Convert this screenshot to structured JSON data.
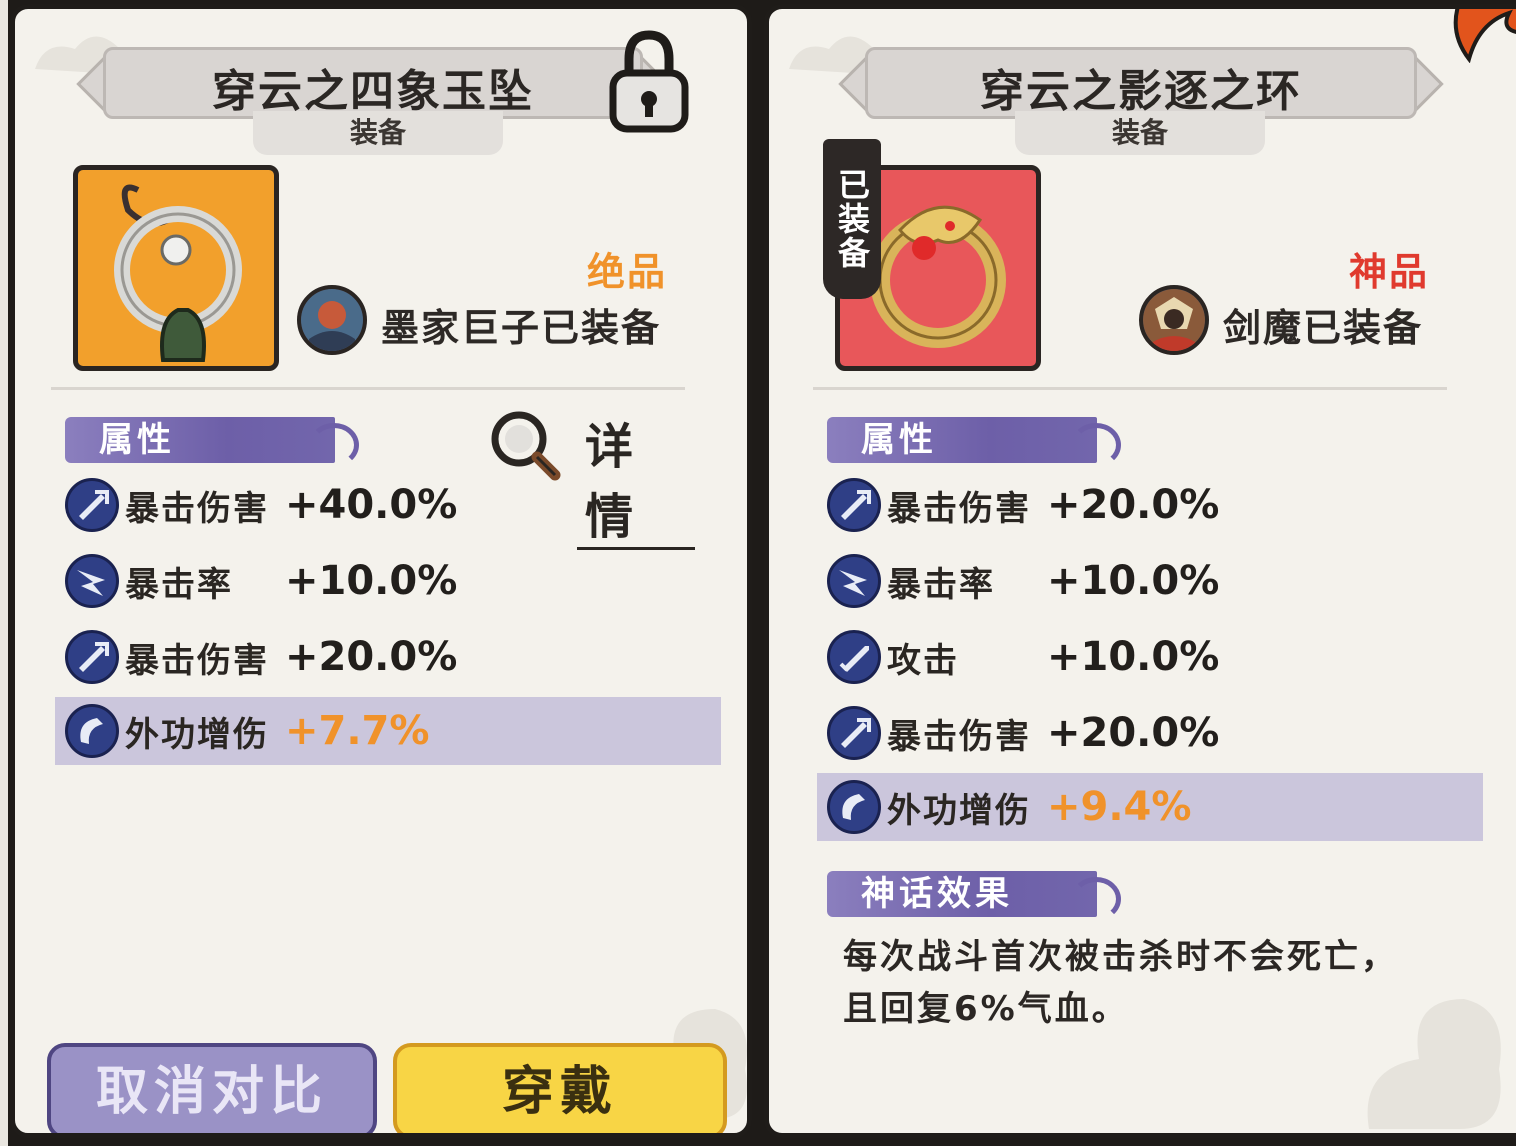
{
  "left_card": {
    "title": "穿云之四象玉坠",
    "subtitle": "装备",
    "rarity": "绝品",
    "rarity_color": "#f0922a",
    "equipped_by": "墨家巨子已装备",
    "attr_section": "属性",
    "detail_label": "详情",
    "stats": [
      {
        "name": "暴击伤害",
        "value": "+40.0%",
        "icon": "crit-damage-icon"
      },
      {
        "name": "暴击率",
        "value": "+10.0%",
        "icon": "crit-rate-icon"
      },
      {
        "name": "暴击伤害",
        "value": "+20.0%",
        "icon": "crit-damage-icon"
      },
      {
        "name": "外功增伤",
        "value": "+7.7%",
        "icon": "external-damage-icon"
      }
    ],
    "cancel_label": "取消对比",
    "wear_label": "穿戴"
  },
  "right_card": {
    "title": "穿云之影逐之环",
    "subtitle": "装备",
    "equipped_banner": "已装备",
    "rarity": "神品",
    "rarity_color": "#e03a2e",
    "equipped_by": "剑魔已装备",
    "attr_section": "属性",
    "stats": [
      {
        "name": "暴击伤害",
        "value": "+20.0%",
        "icon": "crit-damage-icon"
      },
      {
        "name": "暴击率",
        "value": "+10.0%",
        "icon": "crit-rate-icon"
      },
      {
        "name": "攻击",
        "value": "+10.0%",
        "icon": "attack-icon"
      },
      {
        "name": "暴击伤害",
        "value": "+20.0%",
        "icon": "crit-damage-icon"
      },
      {
        "name": "外功增伤",
        "value": "+9.4%",
        "icon": "external-damage-icon"
      }
    ],
    "myth_section": "神话效果",
    "myth_desc": "每次战斗首次被击杀时不会死亡，且回复6%气血。"
  },
  "colors": {
    "highlight_row": "#cbc6dc",
    "accent_orange": "#f0922a",
    "section_purple": "#6d5fa8",
    "cancel_btn": "#9a92c6",
    "wear_btn": "#f8d545"
  }
}
